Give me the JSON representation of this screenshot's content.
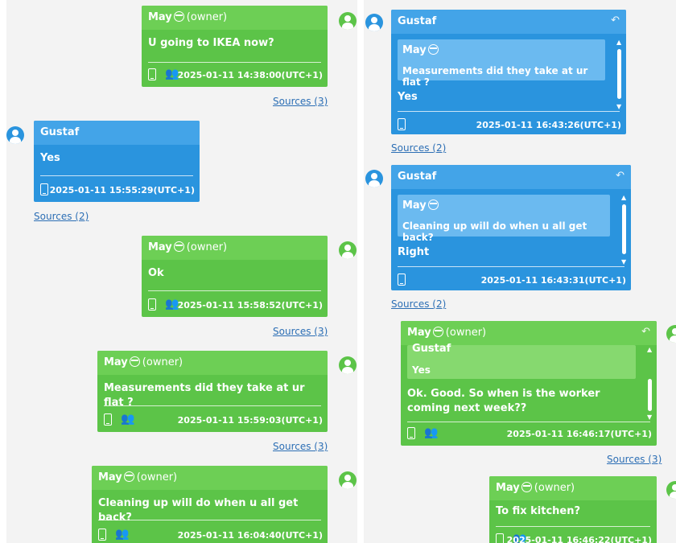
{
  "left": {
    "m1": {
      "author": "May",
      "role": "(owner)",
      "text": "U going to IKEA now?",
      "timestamp": "2025-01-11 14:38:00(UTC+1)",
      "sources": "Sources (3)"
    },
    "m2": {
      "author": "Gustaf",
      "text": "Yes",
      "timestamp": "2025-01-11 15:55:29(UTC+1)",
      "sources": "Sources (2)"
    },
    "m3": {
      "author": "May",
      "role": "(owner)",
      "text": "Ok",
      "timestamp": "2025-01-11 15:58:52(UTC+1)",
      "sources": "Sources (3)"
    },
    "m4": {
      "author": "May",
      "role": "(owner)",
      "text": "Measurements did they take at ur flat ?",
      "timestamp": "2025-01-11 15:59:03(UTC+1)",
      "sources": "Sources (3)"
    },
    "m5": {
      "author": "May",
      "role": "(owner)",
      "text": "Cleaning up will do when u all get back?",
      "timestamp": "2025-01-11 16:04:40(UTC+1)"
    }
  },
  "right": {
    "m6": {
      "author": "Gustaf",
      "quote_author": "May",
      "quote_text": "Measurements did they take at ur flat ?",
      "text": "Yes",
      "timestamp": "2025-01-11 16:43:26(UTC+1)",
      "sources": "Sources (2)"
    },
    "m7": {
      "author": "Gustaf",
      "quote_author": "May",
      "quote_text": "Cleaning up will do when u all get back?",
      "text": "Right",
      "timestamp": "2025-01-11 16:43:31(UTC+1)",
      "sources": "Sources (2)"
    },
    "m8": {
      "author": "May",
      "role": "(owner)",
      "quote_author": "Gustaf",
      "quote_text": "Yes",
      "text": "Ok. Good. So when is the worker coming next week??",
      "timestamp": "2025-01-11 16:46:17(UTC+1)",
      "sources": "Sources (3)"
    },
    "m9": {
      "author": "May",
      "role": "(owner)",
      "text": "To fix kitchen?",
      "timestamp": "2025-01-11 16:46:22(UTC+1)"
    }
  },
  "icons": {
    "reply": "reply-arrow-icon",
    "device": "mobile-device-icon",
    "group": "group-icon",
    "avatar": "user-avatar-icon",
    "emoji": "face-emoji-icon"
  },
  "colors": {
    "owner_bubble": "#5cc448",
    "owner_header": "#6dcf55",
    "other_bubble": "#2a94de",
    "other_header": "#43a4e8",
    "link": "#2d6fb5"
  }
}
